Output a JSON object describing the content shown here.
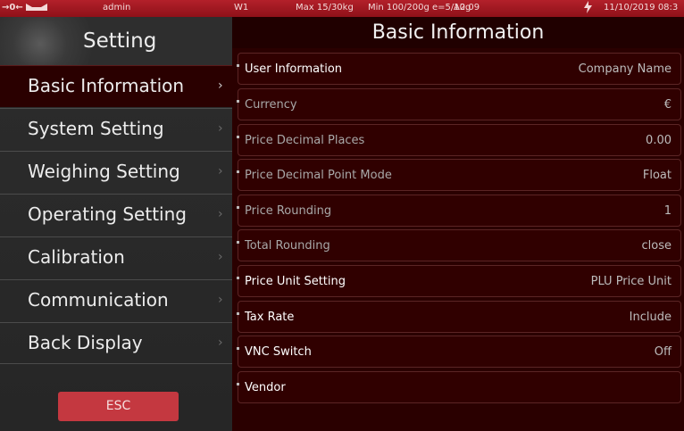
{
  "status_bar": {
    "zero_indicator": "→0←",
    "user": "admin",
    "scale_id": "W1",
    "capacity": "Max 15/30kg",
    "min_division": "Min 100/200g e=5/10g",
    "version": "A2.09",
    "datetime": "11/10/2019 08:3"
  },
  "sidebar": {
    "title": "Setting",
    "items": [
      {
        "label": "Basic Information",
        "active": true
      },
      {
        "label": "System Setting"
      },
      {
        "label": "Weighing Setting"
      },
      {
        "label": "Operating Setting"
      },
      {
        "label": "Calibration"
      },
      {
        "label": "Communication"
      },
      {
        "label": "Back Display"
      }
    ],
    "chevron": "›",
    "esc_label": "ESC"
  },
  "main": {
    "title": "Basic Information",
    "rows": [
      {
        "label": "User Information",
        "value": "Company Name",
        "enabled": true
      },
      {
        "label": "Currency",
        "value": "€",
        "enabled": false
      },
      {
        "label": "Price Decimal Places",
        "value": "0.00",
        "enabled": false
      },
      {
        "label": "Price Decimal Point Mode",
        "value": "Float",
        "enabled": false
      },
      {
        "label": "Price Rounding",
        "value": "1",
        "enabled": false
      },
      {
        "label": "Total Rounding",
        "value": "close",
        "enabled": false
      },
      {
        "label": "Price Unit Setting",
        "value": "PLU Price Unit",
        "enabled": true
      },
      {
        "label": "Tax Rate",
        "value": "Include",
        "enabled": true
      },
      {
        "label": "VNC Switch",
        "value": "Off",
        "enabled": true
      },
      {
        "label": "Vendor",
        "value": "",
        "enabled": true
      }
    ]
  },
  "colors": {
    "status_bar": "#a51a23",
    "accent": "#c43840",
    "panel_bg": "#2a0000",
    "sidebar_bg": "#2b2b2b"
  }
}
